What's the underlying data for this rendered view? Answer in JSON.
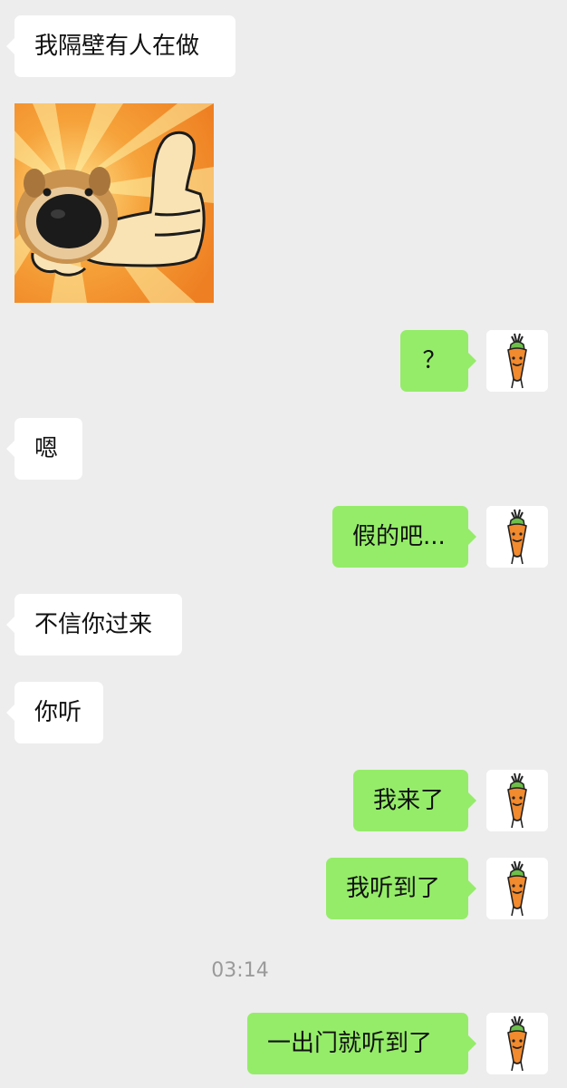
{
  "messages": [
    {
      "text": "我隔壁有人在做"
    },
    {
      "text": "？"
    },
    {
      "text": "嗯"
    },
    {
      "text": "假的吧..."
    },
    {
      "text": "不信你过来"
    },
    {
      "text": "你听"
    },
    {
      "text": "我来了"
    },
    {
      "text": "我听到了"
    },
    {
      "text": "一出门就听到了"
    }
  ],
  "timestamp": "03:14",
  "colors": {
    "background": "#ededed",
    "incoming_bubble": "#ffffff",
    "outgoing_bubble": "#95ec69",
    "timestamp_text": "#9a9a9a"
  },
  "icons": {
    "self_avatar": "carrot-avatar-icon",
    "sticker": "dog-thumbs-up-sticker"
  }
}
